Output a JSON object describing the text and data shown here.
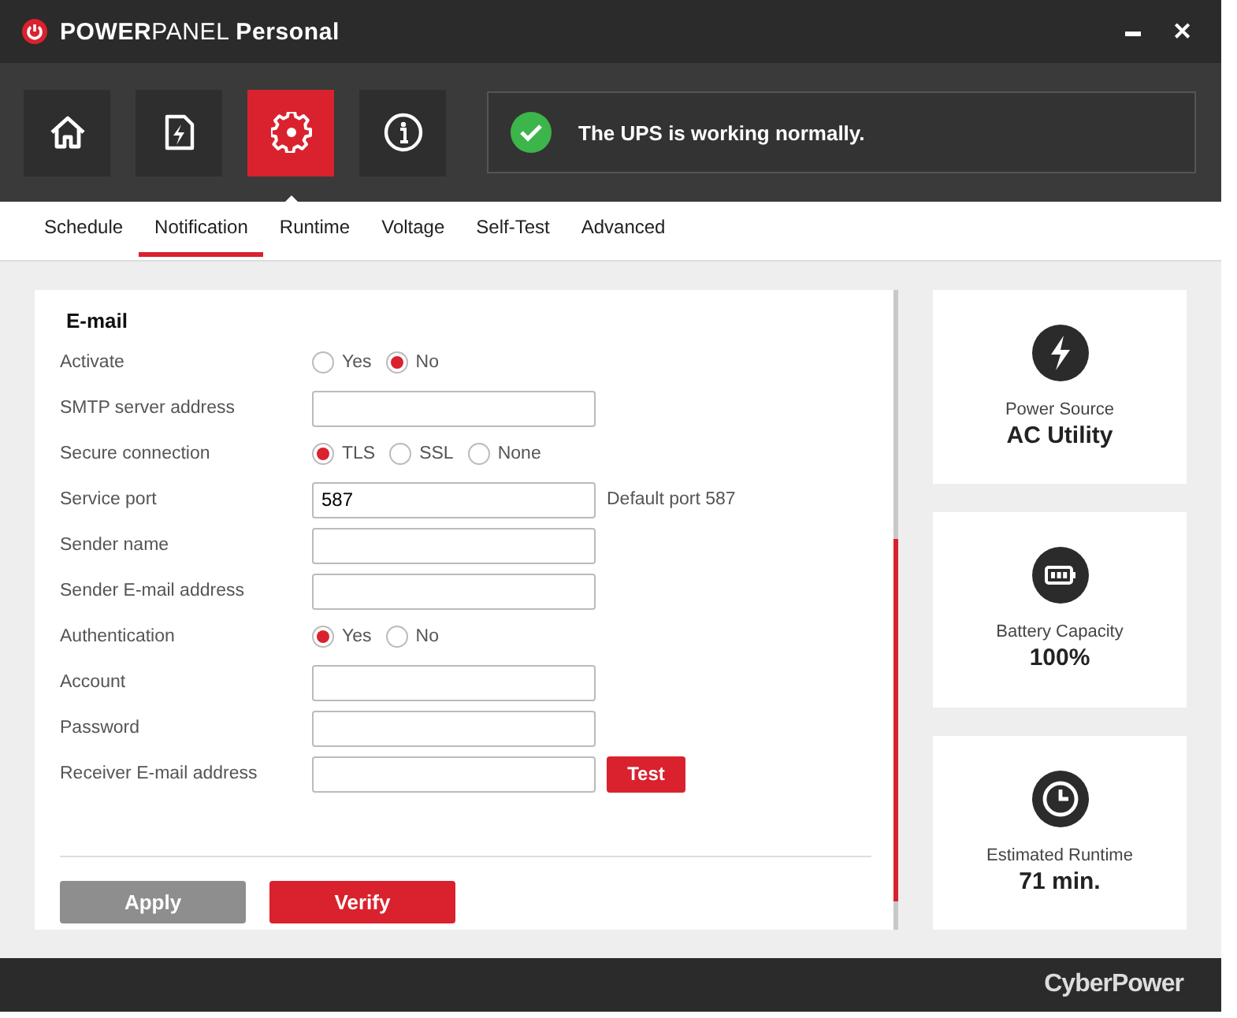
{
  "window": {
    "title": "**POWER**PANEL **Personal**",
    "minimize": "▬",
    "close": "✕"
  },
  "nav": [
    {
      "kind": "home",
      "selected": false
    },
    {
      "kind": "power",
      "selected": false
    },
    {
      "kind": "settings",
      "selected": true
    },
    {
      "kind": "info",
      "selected": false
    }
  ],
  "status": {
    "message": "The UPS is working normally.",
    "ok": true
  },
  "tabs": [
    {
      "label": "Schedule",
      "selected": false
    },
    {
      "label": "Notification",
      "selected": true
    },
    {
      "label": "Runtime",
      "selected": false
    },
    {
      "label": "Voltage",
      "selected": false
    },
    {
      "label": "Self-Test",
      "selected": false
    },
    {
      "label": "Advanced",
      "selected": false
    }
  ],
  "form": {
    "heading": "E-mail",
    "rows": [
      {
        "kind": "radio",
        "label": "Activate",
        "options": [
          {
            "label": "Yes",
            "selected": false
          },
          {
            "label": "No",
            "selected": true
          }
        ]
      },
      {
        "kind": "text",
        "label": "SMTP server address"
      },
      {
        "kind": "radio",
        "label": "Secure connection",
        "options": [
          {
            "label": "TLS",
            "selected": true
          },
          {
            "label": "SSL",
            "selected": false
          },
          {
            "label": "None",
            "selected": false
          }
        ]
      },
      {
        "kind": "text",
        "label": "Service port",
        "value": "587",
        "note": "Default port 587"
      },
      {
        "kind": "text",
        "label": "Sender name"
      },
      {
        "kind": "text",
        "label": "Sender E-mail address"
      },
      {
        "kind": "radio",
        "label": "Authentication",
        "options": [
          {
            "label": "Yes",
            "selected": true
          },
          {
            "label": "No",
            "selected": false
          }
        ]
      },
      {
        "kind": "text",
        "label": "Account"
      },
      {
        "kind": "text",
        "label": "Password"
      },
      {
        "kind": "text",
        "label": "Receiver E-mail address",
        "button": "Test"
      }
    ],
    "buttons": [
      {
        "label": "Apply",
        "disabled": true
      },
      {
        "label": "Verify",
        "disabled": false
      }
    ]
  },
  "cards": [
    {
      "kind": "power",
      "label": "Power Source",
      "value": "AC Utility"
    },
    {
      "kind": "battery",
      "label": "Battery Capacity",
      "value": "100%"
    },
    {
      "kind": "clock",
      "label": "Estimated Runtime",
      "value": "71 min."
    }
  ],
  "footer": {
    "brand": "CyberPower"
  }
}
